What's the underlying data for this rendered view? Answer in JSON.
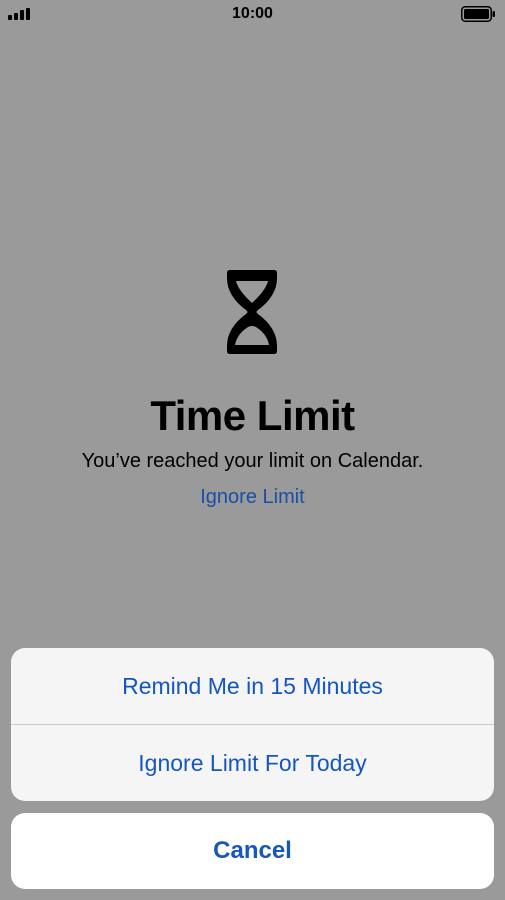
{
  "status_bar": {
    "time": "10:00",
    "signal_icon": "cellular-signal-icon",
    "battery_icon": "battery-icon"
  },
  "screen": {
    "icon": "hourglass-icon",
    "title": "Time Limit",
    "message": "You’ve reached your limit on Calendar.",
    "ignore_link": "Ignore Limit"
  },
  "action_sheet": {
    "items": [
      {
        "label": "Remind Me in 15 Minutes"
      },
      {
        "label": "Ignore Limit For Today"
      }
    ],
    "cancel_label": "Cancel"
  },
  "colors": {
    "background": "#9a9a9a",
    "accent": "#1556c0",
    "sheet": "#f5f5f5",
    "cancel_bg": "#ffffff"
  }
}
